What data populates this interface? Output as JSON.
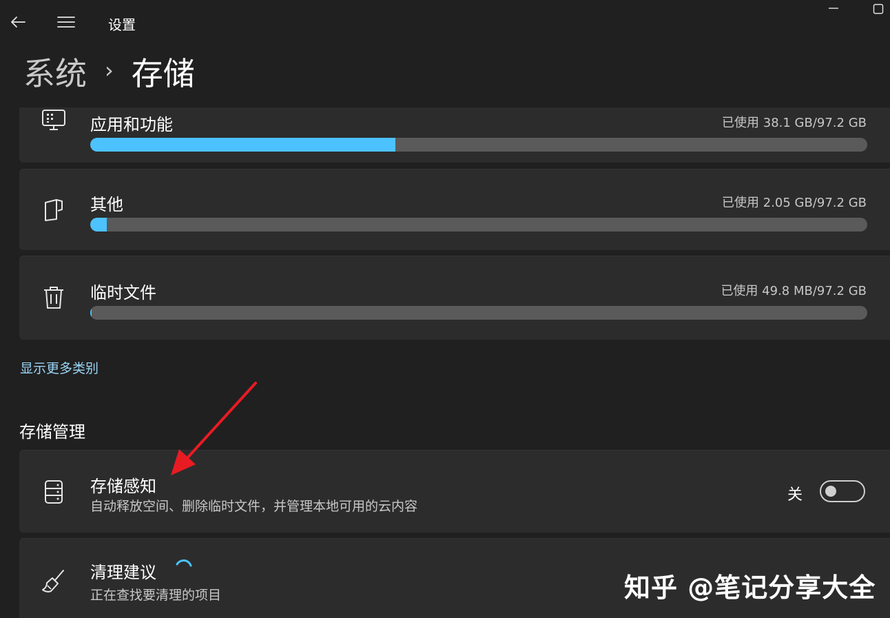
{
  "app": {
    "title": "设置"
  },
  "breadcrumb": {
    "parent": "系统",
    "separator": "›",
    "current": "存储"
  },
  "categories": [
    {
      "label": "应用和功能",
      "usage": "已使用 38.1 GB/97.2 GB",
      "fraction": 0.393,
      "icon": "apps-icon"
    },
    {
      "label": "其他",
      "usage": "已使用 2.05 GB/97.2 GB",
      "fraction": 0.021,
      "icon": "document-icon"
    },
    {
      "label": "临时文件",
      "usage": "已使用 49.8 MB/97.2 GB",
      "fraction": 0.0005,
      "icon": "trash-icon"
    }
  ],
  "show_more": "显示更多类别",
  "storage_management": {
    "title": "存储管理",
    "storage_sense": {
      "label": "存储感知",
      "description": "自动释放空间、删除临时文件，并管理本地可用的云内容",
      "toggle_state": "关",
      "toggle_on": false
    },
    "cleanup": {
      "label": "清理建议",
      "description": "正在查找要清理的项目"
    }
  },
  "watermark": "知乎 @笔记分享大全",
  "colors": {
    "accent": "#4cc2ff",
    "annotation_arrow": "#e81b23",
    "background": "#202020",
    "card": "#2c2c2c"
  }
}
